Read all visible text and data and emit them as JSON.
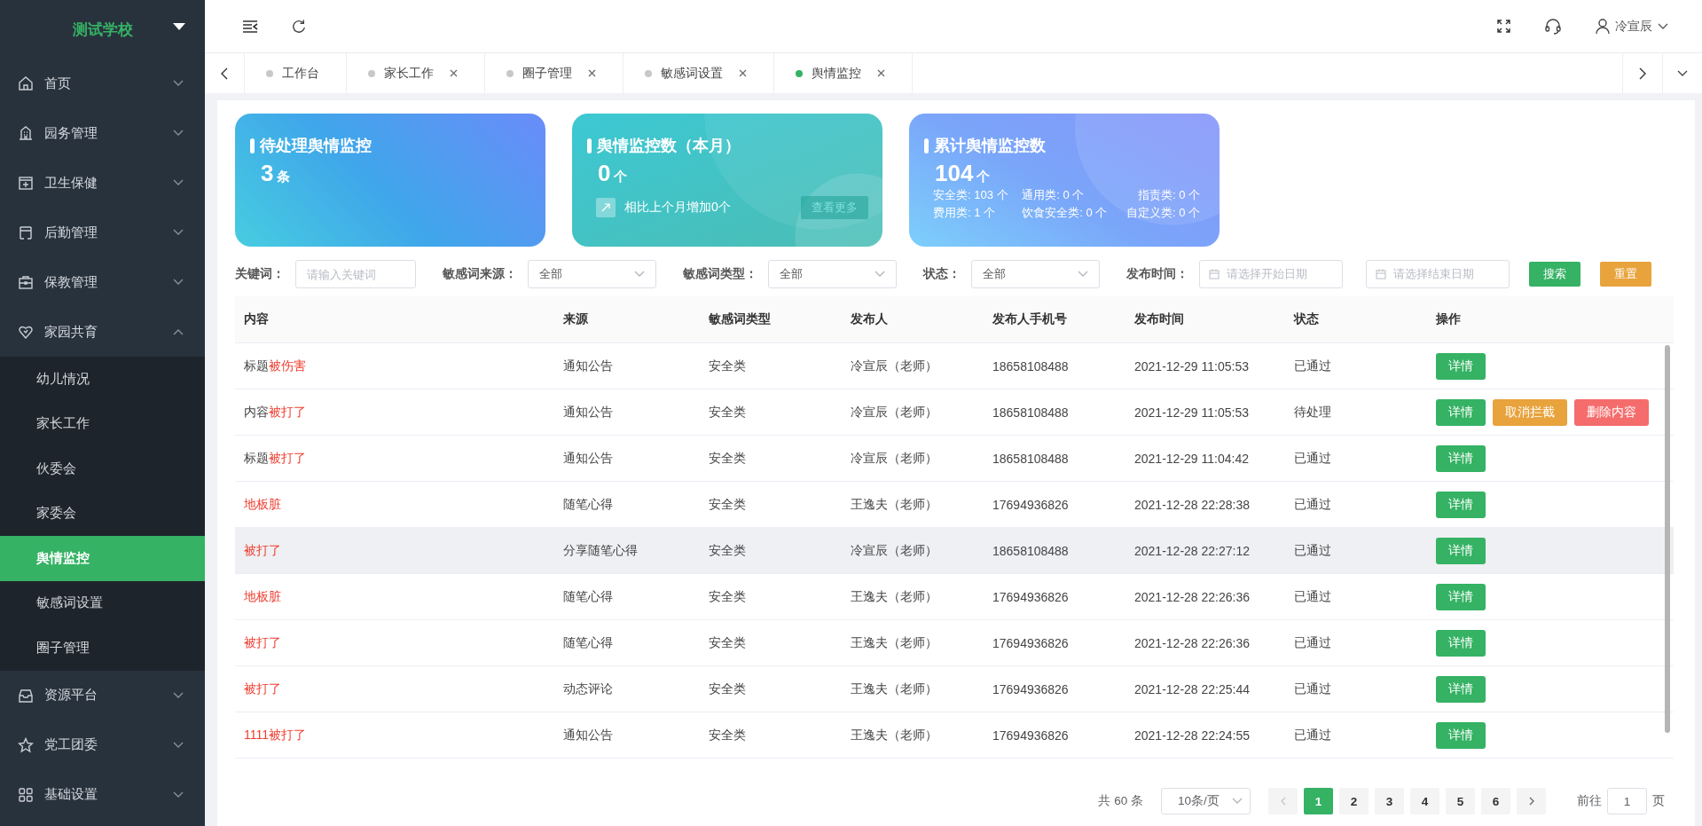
{
  "sidebar": {
    "school": "测试学校",
    "items": [
      {
        "label": "首页",
        "expanded": false
      },
      {
        "label": "园务管理",
        "expanded": false
      },
      {
        "label": "卫生保健",
        "expanded": false
      },
      {
        "label": "后勤管理",
        "expanded": false
      },
      {
        "label": "保教管理",
        "expanded": false
      },
      {
        "label": "家园共育",
        "expanded": true,
        "children": [
          {
            "label": "幼儿情况",
            "selected": false
          },
          {
            "label": "家长工作",
            "selected": false
          },
          {
            "label": "伙委会",
            "selected": false
          },
          {
            "label": "家委会",
            "selected": false
          },
          {
            "label": "舆情监控",
            "selected": true
          },
          {
            "label": "敏感词设置",
            "selected": false
          },
          {
            "label": "圈子管理",
            "selected": false
          }
        ]
      },
      {
        "label": "资源平台",
        "expanded": false
      },
      {
        "label": "党工团委",
        "expanded": false
      },
      {
        "label": "基础设置",
        "expanded": false
      }
    ]
  },
  "header": {
    "user": "冷宣辰"
  },
  "tabs": [
    {
      "label": "工作台",
      "selected": false,
      "closable": false
    },
    {
      "label": "家长工作",
      "selected": false,
      "closable": true
    },
    {
      "label": "圈子管理",
      "selected": false,
      "closable": true
    },
    {
      "label": "敏感词设置",
      "selected": false,
      "closable": true
    },
    {
      "label": "舆情监控",
      "selected": true,
      "closable": true
    }
  ],
  "cards": [
    {
      "kind": "simple",
      "title": "待处理舆情监控",
      "value": "3",
      "unit": "条"
    },
    {
      "kind": "compare",
      "title": "舆情监控数（本月）",
      "value": "0",
      "unit": "个",
      "note": "相比上个月增加0个",
      "button": "查看更多"
    },
    {
      "kind": "breakdown",
      "title": "累计舆情监控数",
      "value": "104",
      "unit": "个",
      "stats": [
        "安全类: 103 个",
        "通用类: 0 个",
        "指责类: 0 个",
        "费用类: 1 个",
        "饮食安全类: 0 个",
        "自定义类: 0 个"
      ]
    }
  ],
  "filters": [
    {
      "kind": "text",
      "label": "关键词：",
      "placeholder": "请输入关键词"
    },
    {
      "kind": "select",
      "label": "敏感词来源：",
      "value": "全部"
    },
    {
      "kind": "select",
      "label": "敏感词类型：",
      "value": "全部"
    },
    {
      "kind": "select",
      "label": "状态：",
      "value": "全部"
    },
    {
      "kind": "date",
      "label": "发布时间：",
      "placeholder": "请选择开始日期"
    },
    {
      "kind": "date",
      "placeholder": "请选择结束日期"
    }
  ],
  "filter_buttons": [
    {
      "kind": "search",
      "label": "搜索"
    },
    {
      "kind": "reset",
      "label": "重置"
    }
  ],
  "table": {
    "columns": [
      "内容",
      "来源",
      "敏感词类型",
      "发布人",
      "发布人手机号",
      "发布时间",
      "状态",
      "操作"
    ],
    "rows": [
      {
        "content": {
          "prefix": "标题",
          "keyword": "被伤害"
        },
        "source": "通知公告",
        "type": "安全类",
        "publisher": "冷宣辰（老师）",
        "phone": "18658108488",
        "time": "2021-12-29 11:05:53",
        "status": "已通过",
        "selected": false,
        "actions": [
          {
            "kind": "detail",
            "label": "详情"
          }
        ]
      },
      {
        "content": {
          "prefix": "内容",
          "keyword": "被打了"
        },
        "source": "通知公告",
        "type": "安全类",
        "publisher": "冷宣辰（老师）",
        "phone": "18658108488",
        "time": "2021-12-29 11:05:53",
        "status": "待处理",
        "selected": false,
        "actions": [
          {
            "kind": "detail",
            "label": "详情"
          },
          {
            "kind": "cancel",
            "label": "取消拦截"
          },
          {
            "kind": "delete",
            "label": "删除内容"
          }
        ]
      },
      {
        "content": {
          "prefix": "标题",
          "keyword": "被打了"
        },
        "source": "通知公告",
        "type": "安全类",
        "publisher": "冷宣辰（老师）",
        "phone": "18658108488",
        "time": "2021-12-29 11:04:42",
        "status": "已通过",
        "selected": false,
        "actions": [
          {
            "kind": "detail",
            "label": "详情"
          }
        ]
      },
      {
        "content": {
          "keyword": "地板脏"
        },
        "source": "随笔心得",
        "type": "安全类",
        "publisher": "王逸夫（老师）",
        "phone": "17694936826",
        "time": "2021-12-28 22:28:38",
        "status": "已通过",
        "selected": false,
        "actions": [
          {
            "kind": "detail",
            "label": "详情"
          }
        ]
      },
      {
        "content": {
          "keyword": "被打了"
        },
        "source": "分享随笔心得",
        "type": "安全类",
        "publisher": "冷宣辰（老师）",
        "phone": "18658108488",
        "time": "2021-12-28 22:27:12",
        "status": "已通过",
        "selected": true,
        "actions": [
          {
            "kind": "detail",
            "label": "详情"
          }
        ]
      },
      {
        "content": {
          "keyword": "地板脏"
        },
        "source": "随笔心得",
        "type": "安全类",
        "publisher": "王逸夫（老师）",
        "phone": "17694936826",
        "time": "2021-12-28 22:26:36",
        "status": "已通过",
        "selected": false,
        "actions": [
          {
            "kind": "detail",
            "label": "详情"
          }
        ]
      },
      {
        "content": {
          "keyword": "被打了"
        },
        "source": "随笔心得",
        "type": "安全类",
        "publisher": "王逸夫（老师）",
        "phone": "17694936826",
        "time": "2021-12-28 22:26:36",
        "status": "已通过",
        "selected": false,
        "actions": [
          {
            "kind": "detail",
            "label": "详情"
          }
        ]
      },
      {
        "content": {
          "keyword": "被打了"
        },
        "source": "动态评论",
        "type": "安全类",
        "publisher": "王逸夫（老师）",
        "phone": "17694936826",
        "time": "2021-12-28 22:25:44",
        "status": "已通过",
        "selected": false,
        "actions": [
          {
            "kind": "detail",
            "label": "详情"
          }
        ]
      },
      {
        "content": {
          "keyword": "1111被打了"
        },
        "source": "通知公告",
        "type": "安全类",
        "publisher": "王逸夫（老师）",
        "phone": "17694936826",
        "time": "2021-12-28 22:24:55",
        "status": "已通过",
        "selected": false,
        "actions": [
          {
            "kind": "detail",
            "label": "详情"
          }
        ]
      }
    ]
  },
  "pagination": {
    "total": "共 60 条",
    "page_size": "10条/页",
    "pages": [
      {
        "label": "1",
        "selected": true
      },
      {
        "label": "2",
        "selected": false
      },
      {
        "label": "3",
        "selected": false
      },
      {
        "label": "4",
        "selected": false
      },
      {
        "label": "5",
        "selected": false
      },
      {
        "label": "6",
        "selected": false
      }
    ],
    "goto_label": "前往",
    "goto_value": "1",
    "goto_suffix": "页"
  }
}
